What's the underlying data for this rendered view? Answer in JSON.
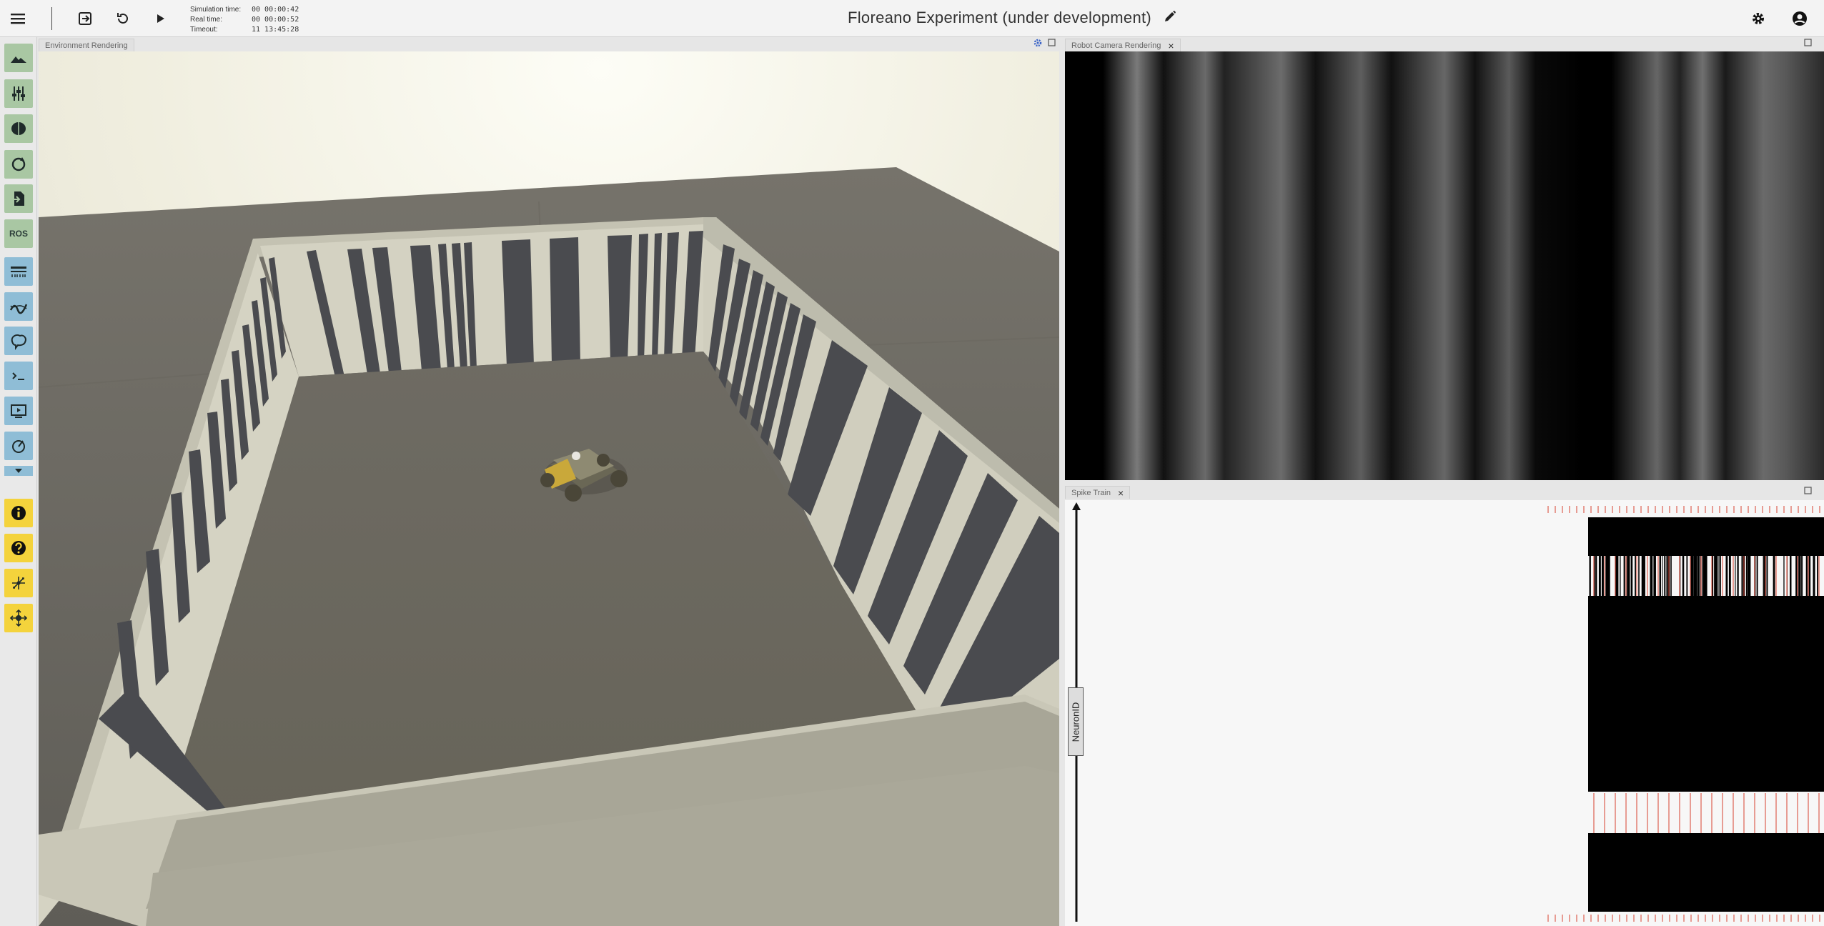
{
  "toolbar": {
    "menu_icon": "hamburger-icon",
    "exit_icon": "exit-icon",
    "reset_icon": "reset-icon",
    "play_icon": "play-icon",
    "sim_time_label": "Simulation time:",
    "sim_time_value": "00 00:00:42",
    "real_time_label": "Real time:",
    "real_time_value": "00 00:00:52",
    "timeout_label": "Timeout:",
    "timeout_value": "11 13:45:28",
    "title": "Floreano Experiment (under development)",
    "edit_icon": "pencil-icon",
    "settings_icon": "gear-icon",
    "account_icon": "account-icon"
  },
  "sidebar": {
    "items": [
      {
        "name": "environment",
        "icon": "mountain-icon",
        "color": "green"
      },
      {
        "name": "object-inspector",
        "icon": "sliders-icon",
        "color": "green"
      },
      {
        "name": "brain-editor",
        "icon": "brain-icon",
        "color": "green"
      },
      {
        "name": "transfer-functions",
        "icon": "cycle-icon",
        "color": "green"
      },
      {
        "name": "import",
        "icon": "file-import-icon",
        "color": "green"
      },
      {
        "name": "ros",
        "label": "ROS",
        "color": "green"
      },
      {
        "name": "spike-train",
        "icon": "spike-icon",
        "color": "blue"
      },
      {
        "name": "joint-plot",
        "icon": "plot-icon",
        "color": "blue"
      },
      {
        "name": "brain-visualizer",
        "icon": "brain-viz-icon",
        "color": "blue"
      },
      {
        "name": "log-console",
        "icon": "terminal-icon",
        "color": "blue"
      },
      {
        "name": "video-stream",
        "icon": "video-icon",
        "color": "blue"
      },
      {
        "name": "performance",
        "icon": "gauge-icon",
        "color": "blue"
      },
      {
        "name": "info",
        "icon": "info-icon",
        "color": "yellow"
      },
      {
        "name": "help",
        "icon": "help-icon",
        "color": "yellow"
      },
      {
        "name": "navigation",
        "icon": "navigate-icon",
        "color": "yellow"
      },
      {
        "name": "robot-nav",
        "icon": "robot-move-icon",
        "color": "yellow"
      }
    ]
  },
  "panels": {
    "environment": {
      "title": "Environment Rendering"
    },
    "camera": {
      "title": "Robot Camera Rendering",
      "close": "×"
    },
    "spike": {
      "title": "Spike Train",
      "close": "×",
      "ylabel": "NeuronID"
    }
  },
  "colors": {
    "sidebar_green": "#a9c7a3",
    "sidebar_blue": "#8fbdd6",
    "sidebar_yellow": "#f4d33c",
    "spike_red": "#d7402f"
  }
}
